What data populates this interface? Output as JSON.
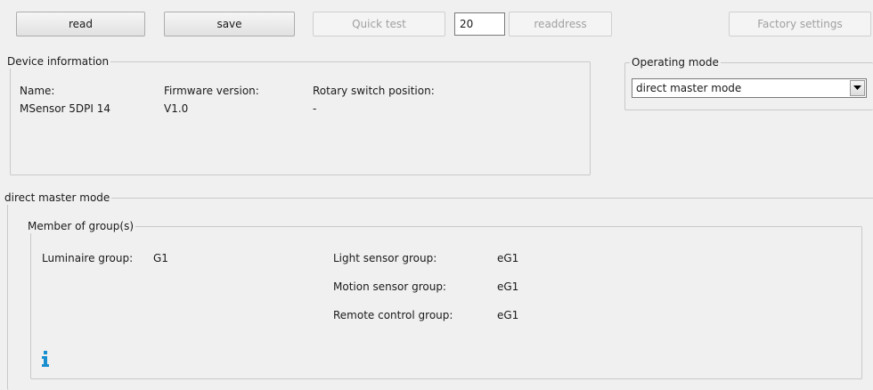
{
  "toolbar": {
    "read_label": "read",
    "save_label": "save",
    "quick_test_label": "Quick test",
    "address_value": "20",
    "readdress_label": "readdress",
    "factory_settings_label": "Factory settings"
  },
  "device_info": {
    "legend": "Device information",
    "name_label": "Name:",
    "name_value": "MSensor 5DPI 14",
    "firmware_label": "Firmware version:",
    "firmware_value": "V1.0",
    "rotary_label": "Rotary switch position:",
    "rotary_value": "-"
  },
  "operating_mode": {
    "legend": "Operating mode",
    "selected": "direct master mode"
  },
  "mode_panel": {
    "legend": "direct master mode",
    "groups": {
      "legend": "Member of group(s)",
      "luminaire_label": "Luminaire group:",
      "luminaire_value": "G1",
      "light_sensor_label": "Light sensor group:",
      "light_sensor_value": "eG1",
      "motion_sensor_label": "Motion sensor group:",
      "motion_sensor_value": "eG1",
      "remote_control_label": "Remote control group:",
      "remote_control_value": "eG1"
    }
  },
  "colors": {
    "background": "#f0f0f0",
    "info_icon": "#1a8fd0",
    "disabled_text": "#a0a0a0"
  },
  "icons": {
    "info": "info-icon",
    "dropdown": "chevron-down-icon"
  }
}
